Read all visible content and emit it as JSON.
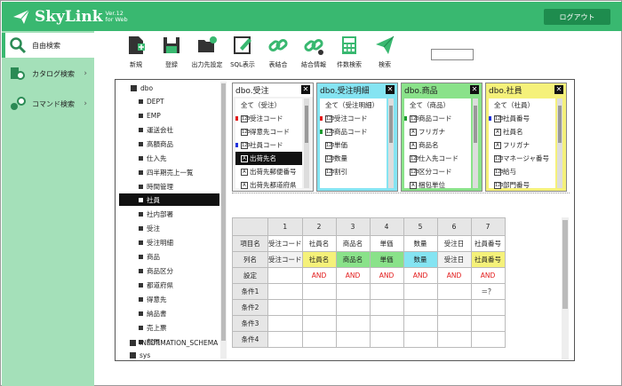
{
  "app": {
    "title": "SkyLink",
    "version": "Ver.12",
    "edition": "for Web",
    "logout_label": "ログアウト"
  },
  "colors": {
    "brand": "#39b870",
    "sidebar": "#a4e0b9",
    "pink": "#ffffff",
    "shipping": "#85e4f2",
    "product": "#8ae28a",
    "employee": "#f5f17a",
    "and": "#e21a1a"
  },
  "sidebar": {
    "items": [
      {
        "label": "自由検索",
        "icon": "search-icon"
      },
      {
        "label": "カタログ検索",
        "icon": "catalog-icon"
      },
      {
        "label": "コマンド検索",
        "icon": "command-icon"
      }
    ]
  },
  "toolbar": {
    "items": [
      {
        "label": "新規",
        "icon": "new-file-icon"
      },
      {
        "label": "登録",
        "icon": "save-icon"
      },
      {
        "label": "出力先設定",
        "icon": "folder-settings-icon"
      },
      {
        "label": "SQL表示",
        "icon": "sql-edit-icon"
      },
      {
        "label": "表結合",
        "icon": "link-icon"
      },
      {
        "label": "結合情報",
        "icon": "link-info-icon"
      },
      {
        "label": "件数検索",
        "icon": "calculator-icon"
      },
      {
        "label": "検索",
        "icon": "send-icon"
      }
    ],
    "search_value": ""
  },
  "tree": {
    "root": "dbo",
    "items": [
      "DEPT",
      "EMP",
      "運送会社",
      "高額商品",
      "仕入先",
      "四半期売上一覧",
      "時間管理",
      "社員",
      "社内部署",
      "受注",
      "受注明細",
      "商品",
      "商品区分",
      "都道府県",
      "得意先",
      "納品書",
      "売上票",
      "部門"
    ],
    "selected": "社員",
    "other_roots": [
      "INFORMATION_SCHEMA",
      "sys"
    ]
  },
  "cards": [
    {
      "title": "dbo.受注",
      "all": "全て（受注）",
      "rows": [
        "受注コード",
        "得意先コード",
        "社員コード",
        "出荷先名",
        "出荷先郵便番号",
        "出荷先都道府県"
      ]
    },
    {
      "title": "dbo.受注明細",
      "all": "全て（受注明細）",
      "rows": [
        "受注コード",
        "商品コード",
        "単価",
        "数量",
        "割引"
      ]
    },
    {
      "title": "dbo.商品",
      "all": "全て（商品）",
      "rows": [
        "商品コード",
        "フリガナ",
        "商品名",
        "仕入先コード",
        "区分コード",
        "梱包単位"
      ]
    },
    {
      "title": "dbo.社員",
      "all": "全て（社員）",
      "rows": [
        "社員番号",
        "社員名",
        "フリガナ",
        "マネージャ番号",
        "給与",
        "部門番号"
      ]
    }
  ],
  "grid": {
    "row_labels": [
      "項目名",
      "列名",
      "設定",
      "条件1",
      "条件2",
      "条件3",
      "条件4",
      "条件5"
    ],
    "columns": [
      {
        "num": "1",
        "item": "受注コード",
        "col": "受注コード",
        "setting": "",
        "cond1": ""
      },
      {
        "num": "2",
        "item": "社員名",
        "col": "社員名",
        "setting": "AND",
        "cond1": ""
      },
      {
        "num": "3",
        "item": "商品名",
        "col": "商品名",
        "setting": "AND",
        "cond1": ""
      },
      {
        "num": "4",
        "item": "単価",
        "col": "単価",
        "setting": "AND",
        "cond1": ""
      },
      {
        "num": "5",
        "item": "数量",
        "col": "数量",
        "setting": "AND",
        "cond1": ""
      },
      {
        "num": "6",
        "item": "受注日",
        "col": "受注日",
        "setting": "AND",
        "cond1": ""
      },
      {
        "num": "7",
        "item": "社員番号",
        "col": "社員番号",
        "setting": "AND",
        "cond1": "＝？"
      }
    ]
  }
}
